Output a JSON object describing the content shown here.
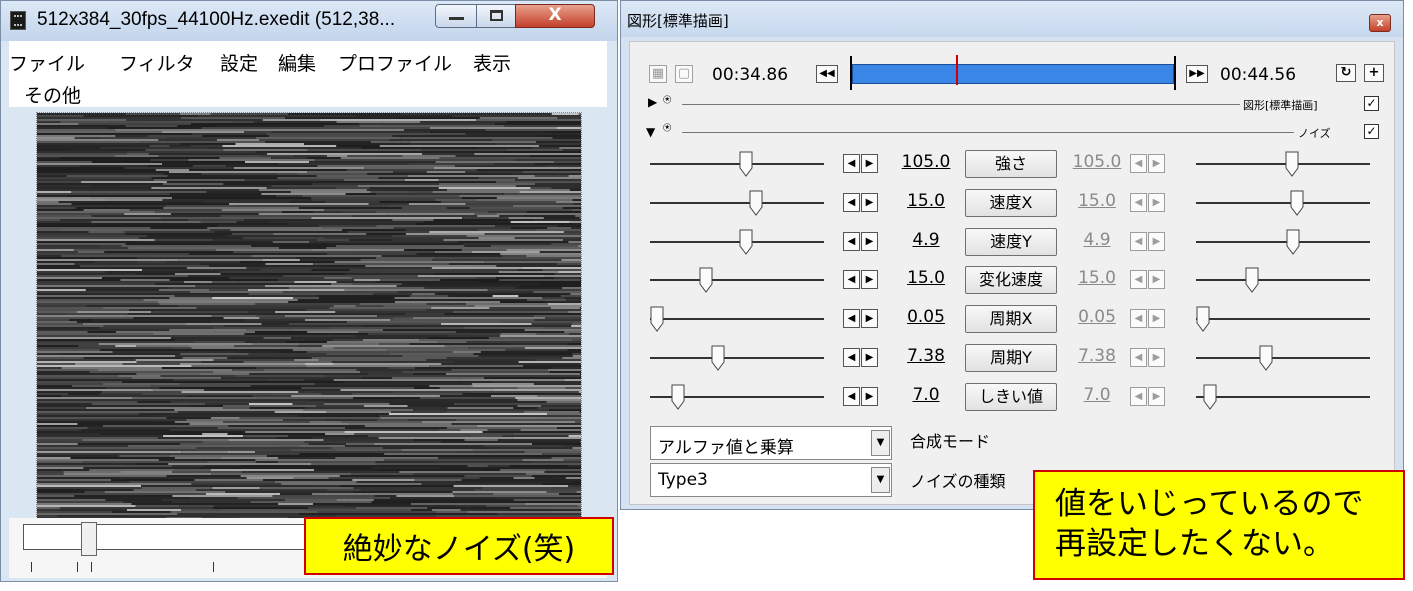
{
  "left_window": {
    "title": "512x384_30fps_44100Hz.exedit (512,38...",
    "close_glyph": "X",
    "menu": [
      "ファイル",
      "フィルタ",
      "設定",
      "編集",
      "プロファイル",
      "表示",
      "その他"
    ]
  },
  "left_caption": "絶妙なノイズ(笑)",
  "right_window": {
    "title": "図形[標準描画]",
    "close_glyph": "x",
    "start_time": "00:34.86",
    "end_time": "00:44.56",
    "rewind_glyph": "◀◀",
    "forward_glyph": "▶▶",
    "refresh_glyph": "↻",
    "plus_glyph": "+",
    "section1_label": "図形[標準描画]",
    "section2_label": "ノイズ",
    "check_glyph": "✓",
    "params": [
      {
        "value": "105.0",
        "label": "強さ",
        "value_right": "105.0",
        "left_pos": 0.55,
        "right_pos": 0.55
      },
      {
        "value": "15.0",
        "label": "速度X",
        "value_right": "15.0",
        "left_pos": 0.61,
        "right_pos": 0.58
      },
      {
        "value": "4.9",
        "label": "速度Y",
        "value_right": "4.9",
        "left_pos": 0.55,
        "right_pos": 0.56
      },
      {
        "value": "15.0",
        "label": "変化速度",
        "value_right": "15.0",
        "left_pos": 0.32,
        "right_pos": 0.32
      },
      {
        "value": "0.05",
        "label": "周期X",
        "value_right": "0.05",
        "left_pos": 0.04,
        "right_pos": 0.04
      },
      {
        "value": "7.38",
        "label": "周期Y",
        "value_right": "7.38",
        "left_pos": 0.39,
        "right_pos": 0.4
      },
      {
        "value": "7.0",
        "label": "しきい値",
        "value_right": "7.0",
        "left_pos": 0.16,
        "right_pos": 0.08
      }
    ],
    "blend_mode": {
      "value": "アルファ値と乗算",
      "label": "合成モード"
    },
    "noise_type": {
      "value": "Type3",
      "label": "ノイズの種類"
    }
  },
  "right_caption": [
    "値をいじっているので",
    "再設定したくない。"
  ]
}
